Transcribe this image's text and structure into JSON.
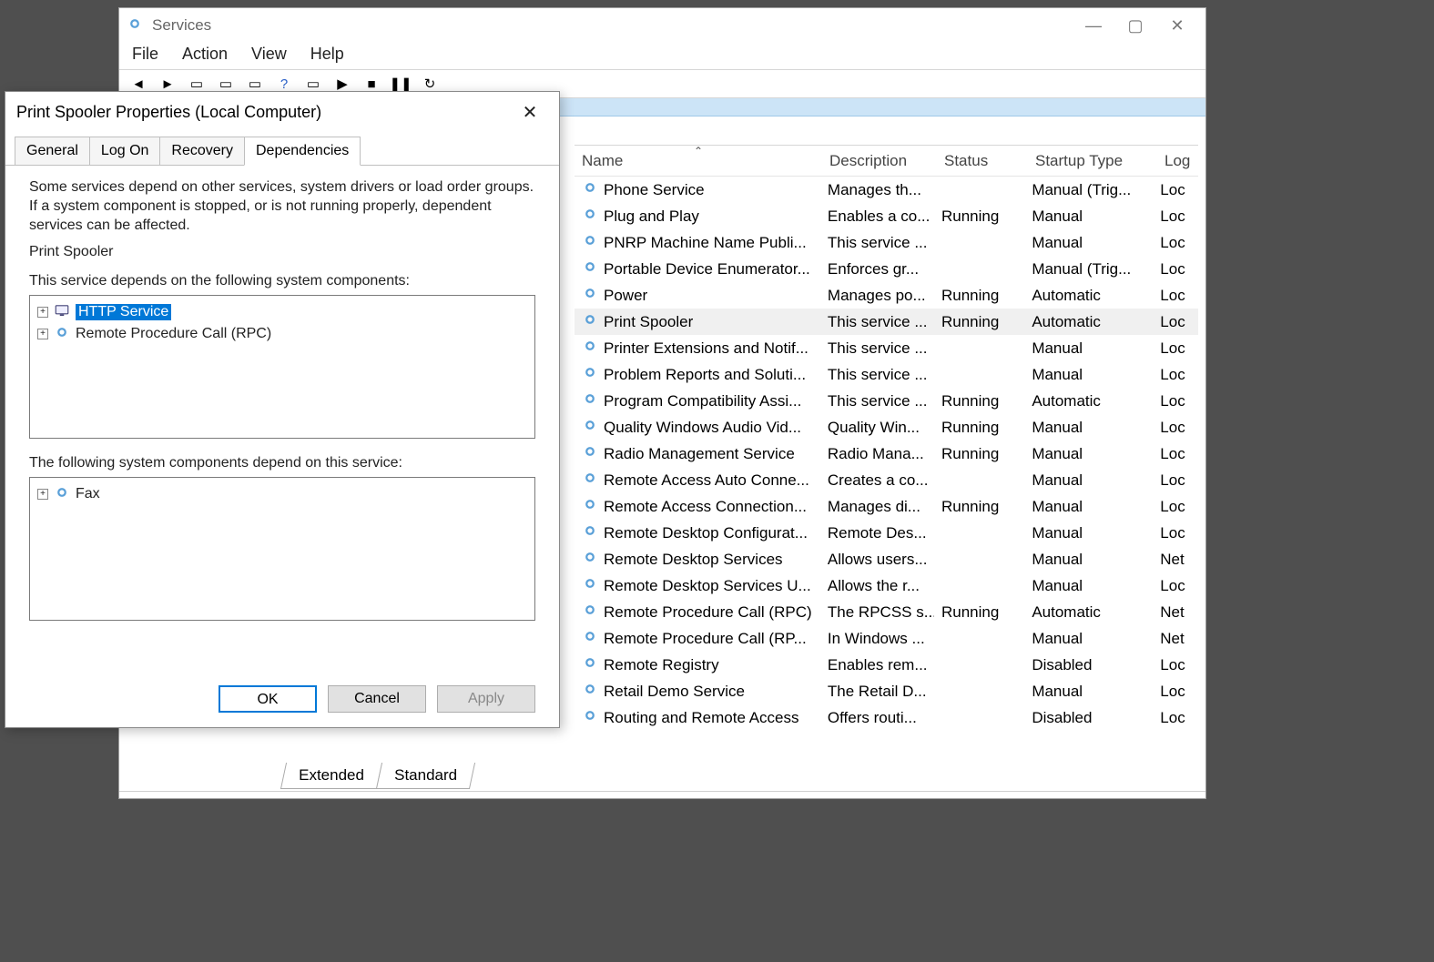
{
  "main": {
    "title": "Services",
    "menu": [
      "File",
      "Action",
      "View",
      "Help"
    ],
    "columns": [
      "Name",
      "Description",
      "Status",
      "Startup Type",
      "Log"
    ],
    "bottom_tabs": [
      "Extended",
      "Standard"
    ],
    "selected_row": 5,
    "rows": [
      {
        "name": "Phone Service",
        "desc": "Manages th...",
        "status": "",
        "start": "Manual (Trig...",
        "logon": "Loc"
      },
      {
        "name": "Plug and Play",
        "desc": "Enables a co...",
        "status": "Running",
        "start": "Manual",
        "logon": "Loc"
      },
      {
        "name": "PNRP Machine Name Publi...",
        "desc": "This service ...",
        "status": "",
        "start": "Manual",
        "logon": "Loc"
      },
      {
        "name": "Portable Device Enumerator...",
        "desc": "Enforces gr...",
        "status": "",
        "start": "Manual (Trig...",
        "logon": "Loc"
      },
      {
        "name": "Power",
        "desc": "Manages po...",
        "status": "Running",
        "start": "Automatic",
        "logon": "Loc"
      },
      {
        "name": "Print Spooler",
        "desc": "This service ...",
        "status": "Running",
        "start": "Automatic",
        "logon": "Loc"
      },
      {
        "name": "Printer Extensions and Notif...",
        "desc": "This service ...",
        "status": "",
        "start": "Manual",
        "logon": "Loc"
      },
      {
        "name": "Problem Reports and Soluti...",
        "desc": "This service ...",
        "status": "",
        "start": "Manual",
        "logon": "Loc"
      },
      {
        "name": "Program Compatibility Assi...",
        "desc": "This service ...",
        "status": "Running",
        "start": "Automatic",
        "logon": "Loc"
      },
      {
        "name": "Quality Windows Audio Vid...",
        "desc": "Quality Win...",
        "status": "Running",
        "start": "Manual",
        "logon": "Loc"
      },
      {
        "name": "Radio Management Service",
        "desc": "Radio Mana...",
        "status": "Running",
        "start": "Manual",
        "logon": "Loc"
      },
      {
        "name": "Remote Access Auto Conne...",
        "desc": "Creates a co...",
        "status": "",
        "start": "Manual",
        "logon": "Loc"
      },
      {
        "name": "Remote Access Connection...",
        "desc": "Manages di...",
        "status": "Running",
        "start": "Manual",
        "logon": "Loc"
      },
      {
        "name": "Remote Desktop Configurat...",
        "desc": "Remote Des...",
        "status": "",
        "start": "Manual",
        "logon": "Loc"
      },
      {
        "name": "Remote Desktop Services",
        "desc": "Allows users...",
        "status": "",
        "start": "Manual",
        "logon": "Net"
      },
      {
        "name": "Remote Desktop Services U...",
        "desc": "Allows the r...",
        "status": "",
        "start": "Manual",
        "logon": "Loc"
      },
      {
        "name": "Remote Procedure Call (RPC)",
        "desc": "The RPCSS s...",
        "status": "Running",
        "start": "Automatic",
        "logon": "Net"
      },
      {
        "name": "Remote Procedure Call (RP...",
        "desc": "In Windows ...",
        "status": "",
        "start": "Manual",
        "logon": "Net"
      },
      {
        "name": "Remote Registry",
        "desc": "Enables rem...",
        "status": "",
        "start": "Disabled",
        "logon": "Loc"
      },
      {
        "name": "Retail Demo Service",
        "desc": "The Retail D...",
        "status": "",
        "start": "Manual",
        "logon": "Loc"
      },
      {
        "name": "Routing and Remote Access",
        "desc": "Offers routi...",
        "status": "",
        "start": "Disabled",
        "logon": "Loc"
      }
    ]
  },
  "dialog": {
    "title": "Print Spooler Properties (Local Computer)",
    "tabs": [
      "General",
      "Log On",
      "Recovery",
      "Dependencies"
    ],
    "active_tab": 3,
    "description": "Some services depend on other services, system drivers or load order groups. If a system component is stopped, or is not running properly, dependent services can be affected.",
    "service_name": "Print Spooler",
    "depends_label": "This service depends on the following system components:",
    "depends_items": [
      {
        "label": "HTTP Service",
        "selected": true,
        "icon": "computer"
      },
      {
        "label": "Remote Procedure Call (RPC)",
        "selected": false,
        "icon": "gear"
      }
    ],
    "dependents_label": "The following system components depend on this service:",
    "dependents_items": [
      {
        "label": "Fax",
        "selected": false,
        "icon": "gear"
      }
    ],
    "buttons": {
      "ok": "OK",
      "cancel": "Cancel",
      "apply": "Apply"
    }
  }
}
